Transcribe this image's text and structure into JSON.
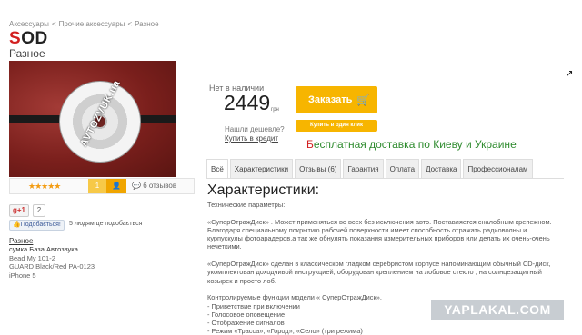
{
  "breadcrumb": [
    "Аксессуары",
    "Прочие аксессуары",
    "Разное"
  ],
  "breadcrumb_sep": "<",
  "product": {
    "title_first": "S",
    "title_rest": "OD",
    "subtitle": "Разное",
    "image_watermark": "AVTOZVUK.ua"
  },
  "rating": {
    "stars": "★★★★★",
    "rate_label": "1",
    "user_icon": "user-icon",
    "reviews": "6 отзывов"
  },
  "social": {
    "gplus": "g+1",
    "gplus_count": "2",
    "share_button": "Подобається!",
    "share_text": "5 людям це подобається"
  },
  "seller": {
    "link": "Разное",
    "lines": [
      "сумка База Автозвука",
      "Bead My 101-2",
      "GUARD Black/Red PA-0123",
      "iPhone 5"
    ]
  },
  "purchase": {
    "in_stock": "Нет в наличии",
    "price": "2449",
    "currency": "грн",
    "found_cheaper": "Нашли дешевле?",
    "credit": "Купить в кредит",
    "order_button": "Заказать",
    "oneclick_button": "Купить в один клик",
    "accent_color": "#f7b500"
  },
  "delivery": {
    "first": "Б",
    "rest": "есплатная доставка по Киеву и Украине"
  },
  "tabs": [
    "Всё",
    "Характеристики",
    "Отзывы (6)",
    "Гарантия",
    "Оплата",
    "Доставка",
    "Профессионалам"
  ],
  "active_tab": "Всё",
  "section": {
    "heading": "Характеристики:",
    "intro": "Технические параметры:",
    "p1": "«СуперОтражДиск» . Может применяться во всех без исключения авто. Поставляется сналобным крепежном. Благодаря специальному покрытию рабочей поверхности имеет способность отражать радиоволны и курпускулы фотоарадеров,а так же обнулять показания измерительных приборов или делать их очень-очень нечеткими.",
    "p2": "«СуперОтражДиск» сделан в классическом гладком серебристом корпусе напоминающим обычный CD-диск, укомплектован доходчивой инструкцией, оборудован креплением на лобовое стекло , на солнцезащитный козырек и просто лоб.",
    "p3": "Контролируемые функции модели « СуперОтражДиск».",
    "features": [
      "- Приветствие при включении",
      "- Голосовое оповещение",
      "- Отображение сигналов",
      "- Режим «Трасса», «Город», «Село» (три режима)"
    ]
  },
  "watermark": "YAPLAKAL.COM"
}
